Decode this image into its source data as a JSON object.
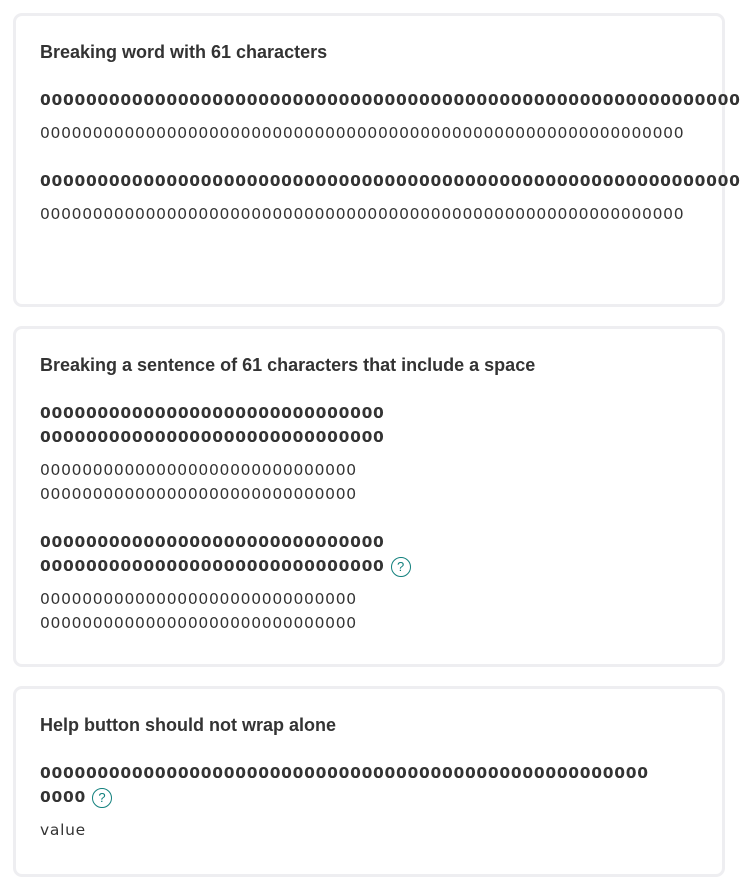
{
  "cards": [
    {
      "title": "Breaking word with 61 characters",
      "fields": [
        {
          "label": "0000000000000000000000000000000000000000000000000000000000000",
          "value": "0000000000000000000000000000000000000000000000000000000000000",
          "help": false
        },
        {
          "label": "0000000000000000000000000000000000000000000000000000000000000",
          "value": "0000000000000000000000000000000000000000000000000000000000000",
          "help": true
        }
      ]
    },
    {
      "title": "Breaking a sentence of 61 characters that include a space",
      "fields": [
        {
          "label": "000000000000000000000000000000 000000000000000000000000000000",
          "value": "000000000000000000000000000000 000000000000000000000000000000",
          "help": false
        },
        {
          "label": "000000000000000000000000000000 000000000000000000000000000000",
          "value": "000000000000000000000000000000 000000000000000000000000000000",
          "help": true
        }
      ]
    },
    {
      "title": "Help button should not wrap alone",
      "fields": [
        {
          "label": "000000000000000000000000000000000000000000000000000000000",
          "value": "value",
          "help": true
        }
      ]
    }
  ],
  "help_icon": {
    "glyph": "?",
    "name": "question-circle-icon",
    "color": "#12807d"
  }
}
